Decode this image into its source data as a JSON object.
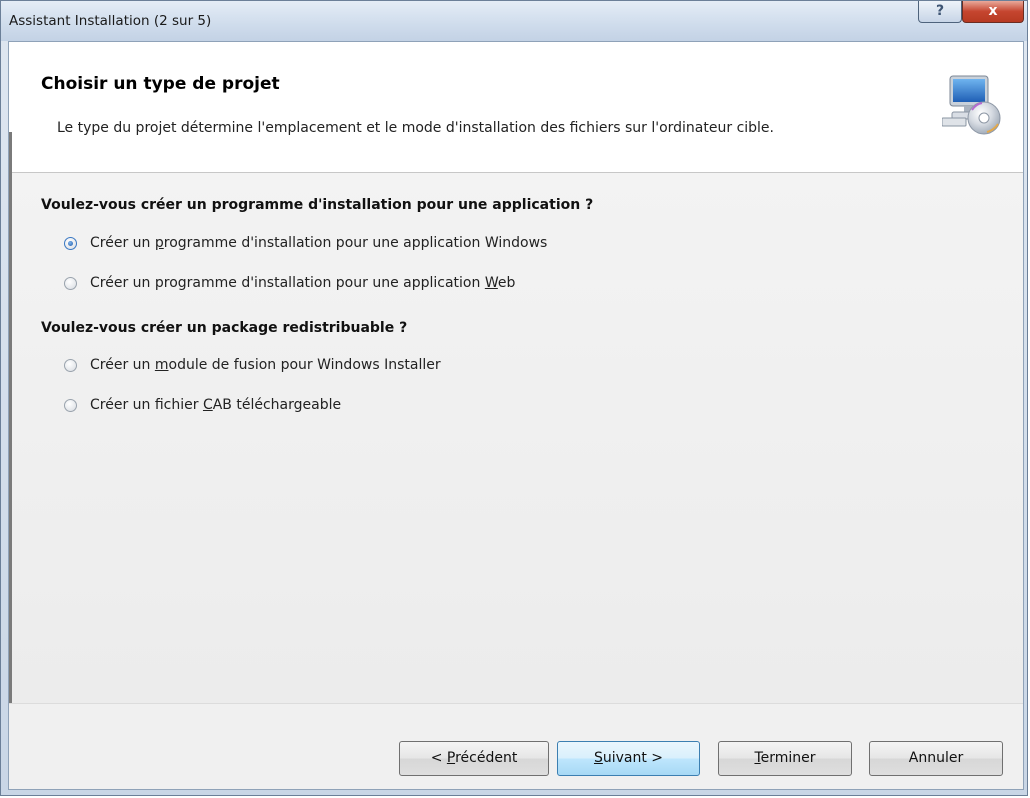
{
  "window": {
    "title": "Assistant Installation (2 sur 5)",
    "help_glyph": "?",
    "close_glyph": "x"
  },
  "header": {
    "title": "Choisir un type de projet",
    "description": "Le type du projet détermine l'emplacement et le mode d'installation des fichiers sur l'ordinateur cible.",
    "icon": "computer-cd-icon"
  },
  "sections": [
    {
      "title": "Voulez-vous créer un programme d'installation pour une application ?",
      "options": [
        {
          "pre": "Créer un ",
          "accel": "p",
          "post": "rogramme d'installation pour une application Windows",
          "checked": true
        },
        {
          "pre": "Créer un programme d'installation pour une application ",
          "accel": "W",
          "post": "eb",
          "checked": false
        }
      ]
    },
    {
      "title": "Voulez-vous créer un package redistribuable ?",
      "options": [
        {
          "pre": "Créer un ",
          "accel": "m",
          "post": "odule de fusion pour Windows Installer",
          "checked": false
        },
        {
          "pre": "Créer un fichier ",
          "accel": "C",
          "post": "AB téléchargeable",
          "checked": false
        }
      ]
    }
  ],
  "buttons": {
    "previous": {
      "pre": "< ",
      "accel": "P",
      "post": "récédent"
    },
    "next": {
      "pre": "",
      "accel": "S",
      "post": "uivant >"
    },
    "finish": {
      "pre": "",
      "accel": "T",
      "post": "erminer"
    },
    "cancel": {
      "pre": "Annuler",
      "accel": "",
      "post": ""
    }
  },
  "colors": {
    "primary_button_border": "#3c7fb1",
    "radio_checked": "#1e5aa8",
    "close_button": "#c5452f"
  }
}
